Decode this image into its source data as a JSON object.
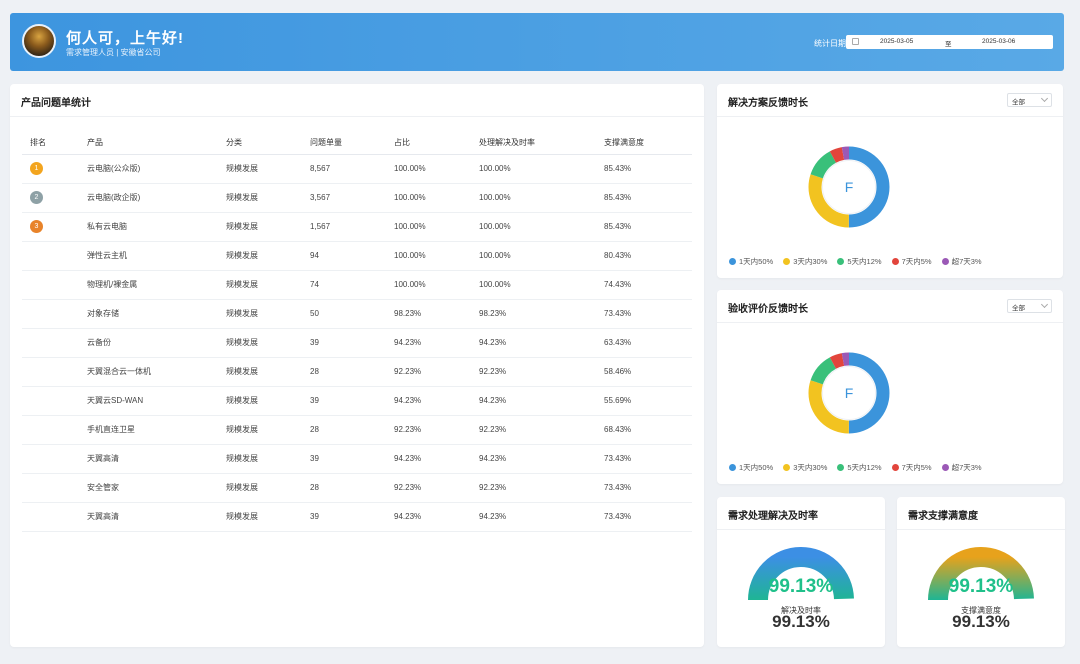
{
  "header": {
    "greeting": "何人可，上午好!",
    "role": "需求管理人员 | 安徽省公司",
    "date_label": "统计日期",
    "date_start": "2025-03-05",
    "date_sep": "至",
    "date_end": "2025-03-06"
  },
  "product_table": {
    "title": "产品问题单统计",
    "columns": [
      "排名",
      "产品",
      "分类",
      "问题单量",
      "占比",
      "处理解决及时率",
      "支撑满意度"
    ],
    "rank_colors": [
      "#f3a51f",
      "#8ea1a6",
      "#e8832a"
    ],
    "rows": [
      {
        "rank": "1",
        "product": "云电脑(公众版)",
        "category": "规模发展",
        "count": "8,567",
        "ratio": "100.00%",
        "rate": "100.00%",
        "satisfaction": "85.43%"
      },
      {
        "rank": "2",
        "product": "云电脑(政企版)",
        "category": "规模发展",
        "count": "3,567",
        "ratio": "100.00%",
        "rate": "100.00%",
        "satisfaction": "85.43%"
      },
      {
        "rank": "3",
        "product": "私有云电脑",
        "category": "规模发展",
        "count": "1,567",
        "ratio": "100.00%",
        "rate": "100.00%",
        "satisfaction": "85.43%"
      },
      {
        "rank": "",
        "product": "弹性云主机",
        "category": "规模发展",
        "count": "94",
        "ratio": "100.00%",
        "rate": "100.00%",
        "satisfaction": "80.43%"
      },
      {
        "rank": "",
        "product": "物理机/裸金属",
        "category": "规模发展",
        "count": "74",
        "ratio": "100.00%",
        "rate": "100.00%",
        "satisfaction": "74.43%"
      },
      {
        "rank": "",
        "product": "对象存储",
        "category": "规模发展",
        "count": "50",
        "ratio": "98.23%",
        "rate": "98.23%",
        "satisfaction": "73.43%"
      },
      {
        "rank": "",
        "product": "云备份",
        "category": "规模发展",
        "count": "39",
        "ratio": "94.23%",
        "rate": "94.23%",
        "satisfaction": "63.43%"
      },
      {
        "rank": "",
        "product": "天翼混合云一体机",
        "category": "规模发展",
        "count": "28",
        "ratio": "92.23%",
        "rate": "92.23%",
        "satisfaction": "58.46%"
      },
      {
        "rank": "",
        "product": "天翼云SD-WAN",
        "category": "规模发展",
        "count": "39",
        "ratio": "94.23%",
        "rate": "94.23%",
        "satisfaction": "55.69%"
      },
      {
        "rank": "",
        "product": "手机直连卫星",
        "category": "规模发展",
        "count": "28",
        "ratio": "92.23%",
        "rate": "92.23%",
        "satisfaction": "68.43%"
      },
      {
        "rank": "",
        "product": "天翼高清",
        "category": "规模发展",
        "count": "39",
        "ratio": "94.23%",
        "rate": "94.23%",
        "satisfaction": "73.43%"
      },
      {
        "rank": "",
        "product": "安全管家",
        "category": "规模发展",
        "count": "28",
        "ratio": "92.23%",
        "rate": "92.23%",
        "satisfaction": "73.43%"
      },
      {
        "rank": "",
        "product": "天翼高清",
        "category": "规模发展",
        "count": "39",
        "ratio": "94.23%",
        "rate": "94.23%",
        "satisfaction": "73.43%"
      }
    ]
  },
  "solution_card": {
    "title": "解决方案反馈时长",
    "filter": "全部",
    "center_text": "F"
  },
  "acceptance_card": {
    "title": "验收评价反馈时长",
    "filter": "全部",
    "center_text": "F"
  },
  "gauge_rate": {
    "title": "需求处理解决及时率",
    "value_text": "99.13%",
    "label": "解决及时率",
    "value": 99.13,
    "colors": [
      "#1fb594",
      "#3c8fe4"
    ]
  },
  "gauge_satisfaction": {
    "title": "需求支撑满意度",
    "value_text": "99.13%",
    "label": "支撑满意度",
    "value": 99.13,
    "colors": [
      "#1fb594",
      "#e7a21c"
    ]
  },
  "chart_data": [
    {
      "type": "pie",
      "title": "解决方案反馈时长",
      "labels": [
        "1天内50%",
        "3天内30%",
        "5天内12%",
        "7天内5%",
        "超7天3%"
      ],
      "values": [
        50,
        30,
        12,
        5,
        3
      ],
      "colors": [
        "#3b94db",
        "#f2c320",
        "#39c07a",
        "#e2453c",
        "#9b59b6"
      ],
      "legend": "bottom"
    },
    {
      "type": "pie",
      "title": "验收评价反馈时长",
      "labels": [
        "1天内50%",
        "3天内30%",
        "5天内12%",
        "7天内5%",
        "超7天3%"
      ],
      "values": [
        50,
        30,
        12,
        5,
        3
      ],
      "colors": [
        "#3b94db",
        "#f2c320",
        "#39c07a",
        "#e2453c",
        "#9b59b6"
      ],
      "legend": "bottom"
    }
  ]
}
